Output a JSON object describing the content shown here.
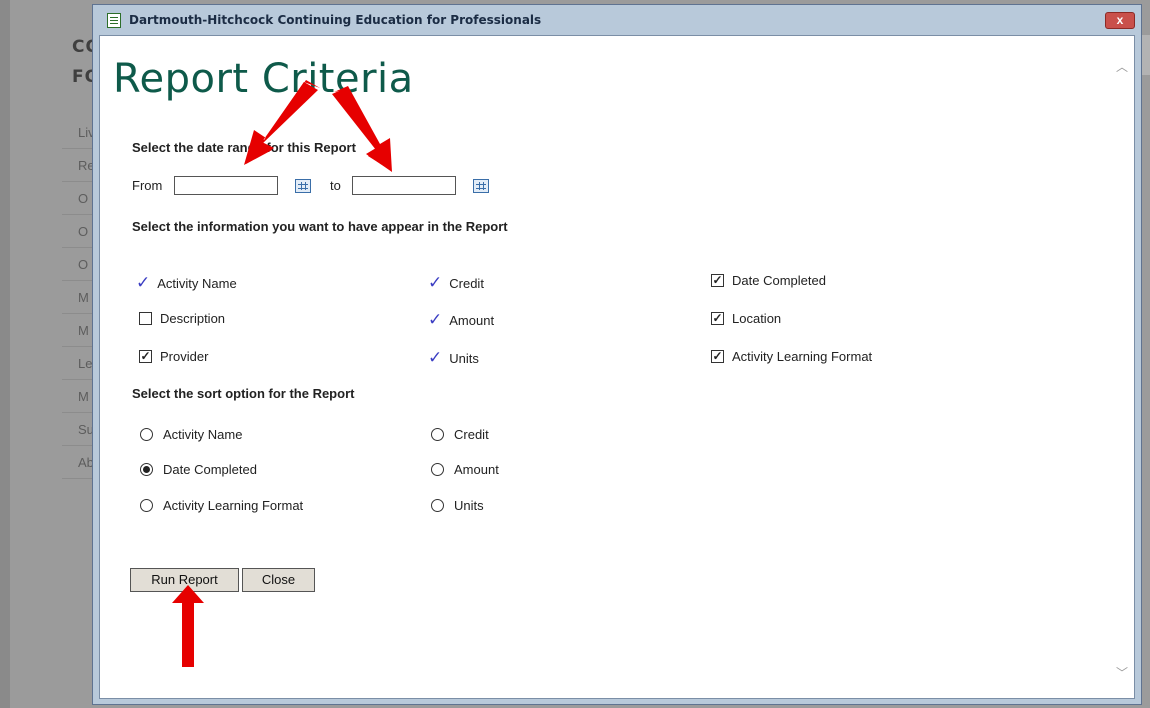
{
  "background": {
    "heading_line1": "CON",
    "heading_line2": "FOR",
    "nav_items": [
      "Liv",
      "Re",
      "O",
      "O",
      "O",
      "M",
      "M",
      "Le",
      "M",
      "Su",
      "Ab"
    ]
  },
  "dialog": {
    "title": "Dartmouth-Hitchcock Continuing Education for Professionals",
    "close_label": "x",
    "report_title": "Report Criteria",
    "date_range": {
      "label": "Select the date range for this Report",
      "from_label": "From",
      "to_label": "to",
      "from_value": "",
      "to_value": ""
    },
    "info_section_label": "Select the information you want to have appear in the Report",
    "info_options": [
      {
        "label": "Activity Name",
        "state": "fixed-check"
      },
      {
        "label": "Credit",
        "state": "fixed-check"
      },
      {
        "label": "Date Completed",
        "state": "checked"
      },
      {
        "label": "Description",
        "state": "unchecked"
      },
      {
        "label": "Amount",
        "state": "fixed-check"
      },
      {
        "label": "Location",
        "state": "checked"
      },
      {
        "label": "Provider",
        "state": "checked"
      },
      {
        "label": "Units",
        "state": "fixed-check"
      },
      {
        "label": "Activity Learning Format",
        "state": "checked"
      }
    ],
    "sort_section_label": "Select the sort option for the Report",
    "sort_options": [
      {
        "label": "Activity Name",
        "selected": false
      },
      {
        "label": "Credit",
        "selected": false
      },
      {
        "label": "Date Completed",
        "selected": true
      },
      {
        "label": "Amount",
        "selected": false
      },
      {
        "label": "Activity Learning Format",
        "selected": false
      },
      {
        "label": "Units",
        "selected": false
      }
    ],
    "run_button": "Run Report",
    "close_button": "Close"
  },
  "colors": {
    "title": "#0e5a4a",
    "tick": "#3b3ec3",
    "arrow": "#e60000"
  }
}
